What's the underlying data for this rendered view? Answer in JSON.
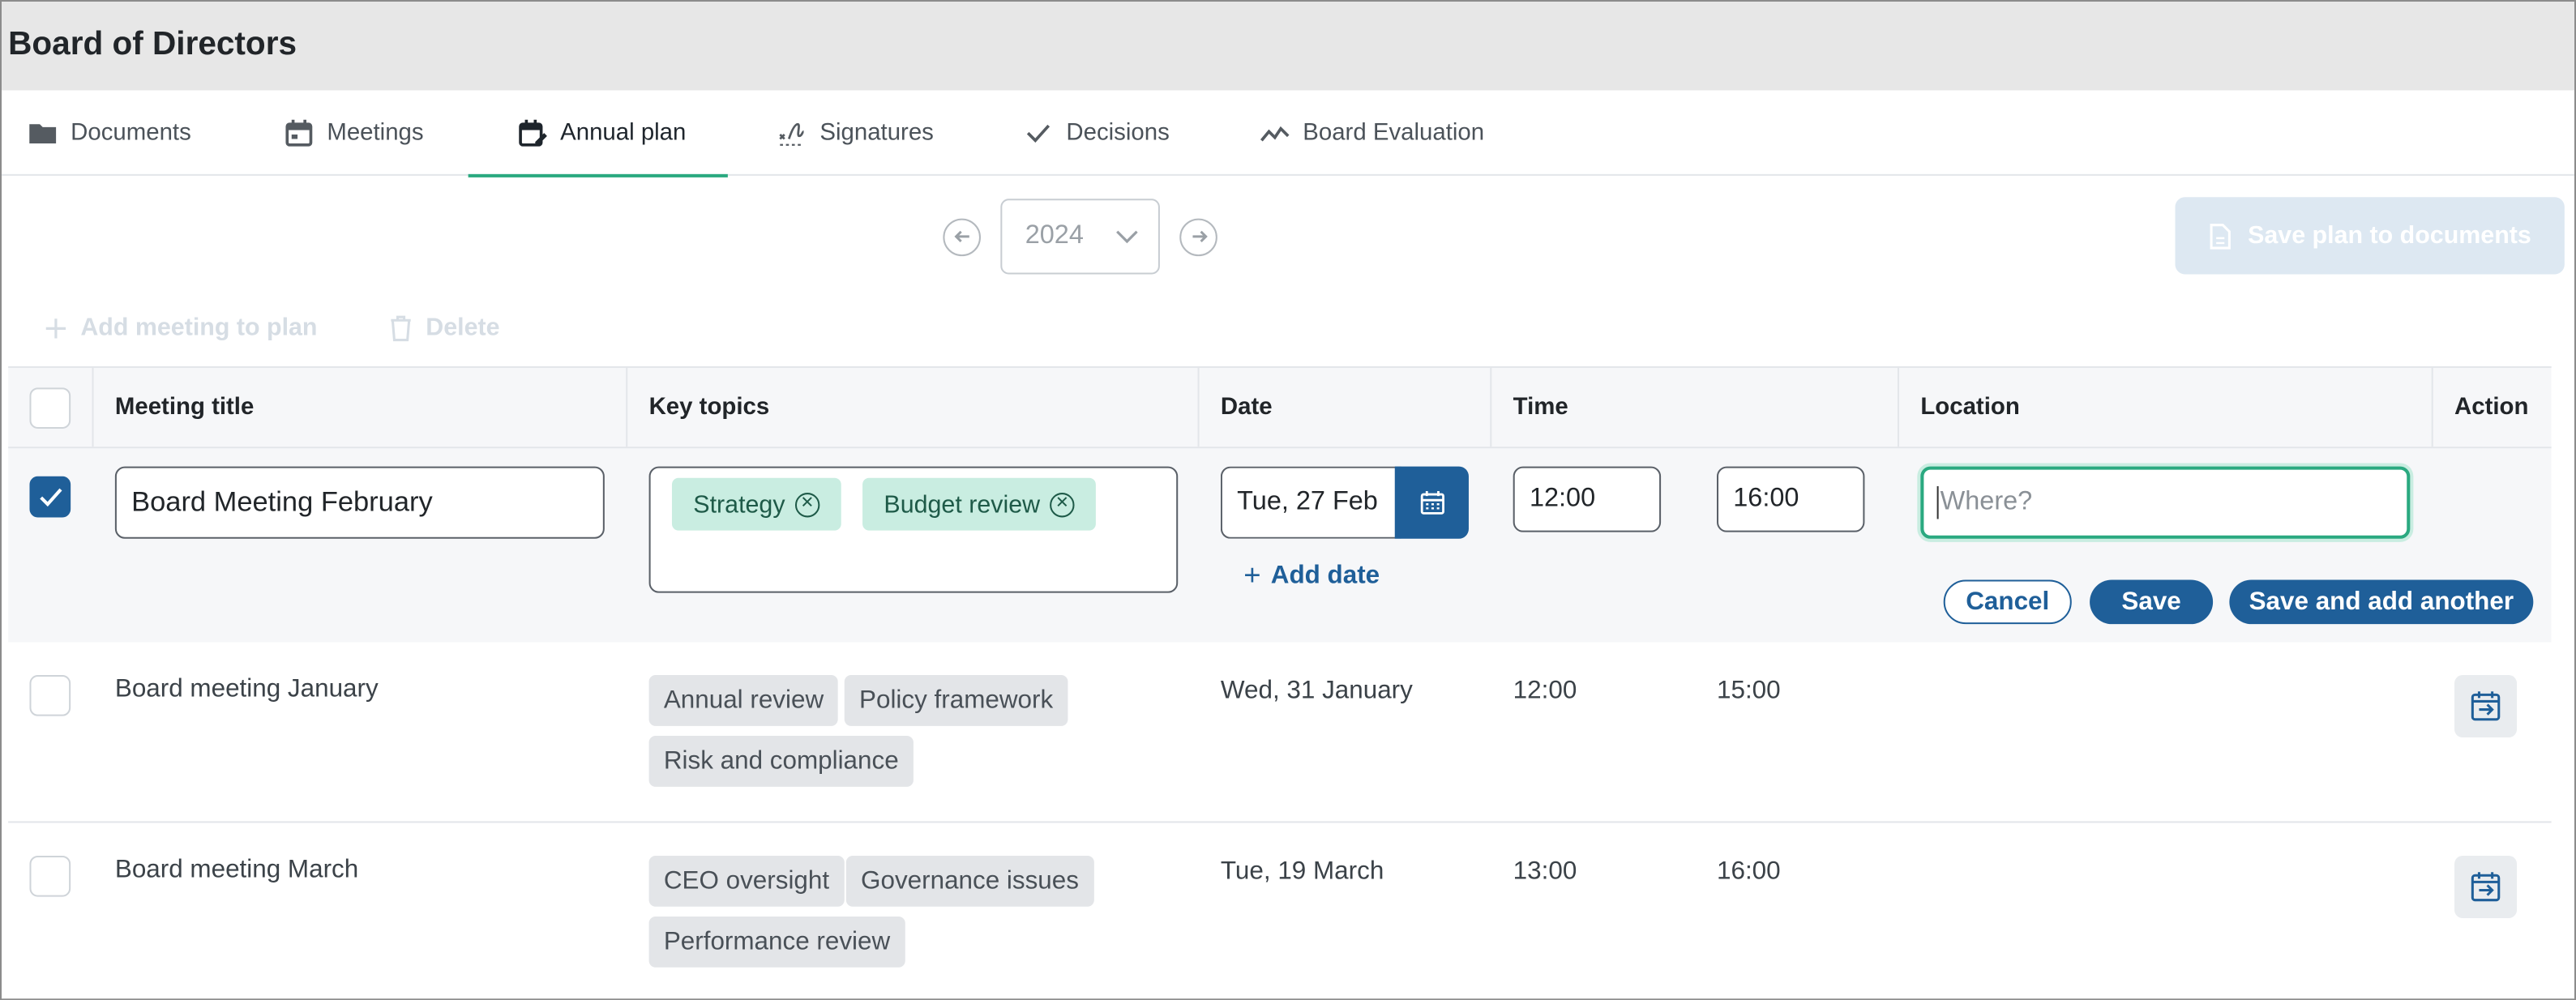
{
  "app": {
    "title": "Board of Directors"
  },
  "tabs": [
    {
      "label": "Documents",
      "icon": "folder-icon"
    },
    {
      "label": "Meetings",
      "icon": "calendar-icon"
    },
    {
      "label": "Annual plan",
      "icon": "calendar-edit-icon",
      "active": true
    },
    {
      "label": "Signatures",
      "icon": "signature-icon"
    },
    {
      "label": "Decisions",
      "icon": "check-icon"
    },
    {
      "label": "Board Evaluation",
      "icon": "trend-icon"
    }
  ],
  "year_nav": {
    "year": "2024"
  },
  "toolbar": {
    "save_plan_label": "Save plan to documents",
    "add_meeting_label": "Add meeting to plan",
    "delete_label": "Delete"
  },
  "table": {
    "headers": [
      "Meeting title",
      "Key topics",
      "Date",
      "Time",
      "Location",
      "Action"
    ],
    "edit_row": {
      "checked": true,
      "title_value": "Board Meeting February",
      "topics": [
        "Strategy",
        "Budget review"
      ],
      "date_value": "Tue, 27 Feb",
      "start_time": "12:00",
      "end_time": "16:00",
      "location_placeholder": "Where?",
      "add_date_label": "Add date",
      "cancel_label": "Cancel",
      "save_label": "Save",
      "save_add_label": "Save and add another"
    },
    "rows": [
      {
        "title": "Board meeting January",
        "topics": [
          "Annual review",
          "Policy framework",
          "Risk and compliance"
        ],
        "date": "Wed, 31 January",
        "start": "12:00",
        "end": "15:00"
      },
      {
        "title": "Board meeting March",
        "topics": [
          "CEO oversight",
          "Governance issues",
          "Performance review"
        ],
        "date": "Tue, 19 March",
        "start": "13:00",
        "end": "16:00"
      }
    ]
  },
  "colors": {
    "accent_green": "#2aa980",
    "primary_blue": "#1f5f99",
    "tag_green_bg": "#c9ede1",
    "tag_gray_bg": "#e3e5e8"
  }
}
